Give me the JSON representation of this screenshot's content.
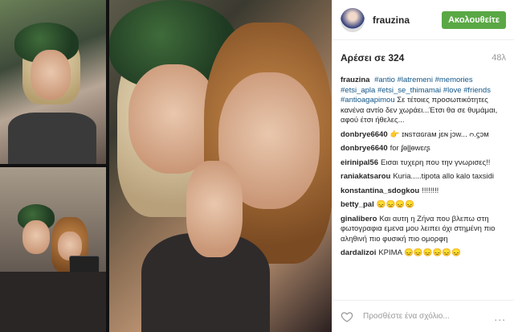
{
  "post": {
    "username": "frauzina",
    "follow_label": "Ακολουθείτε",
    "likes_label": "Αρέσει σε 324",
    "time_ago": "48λ",
    "caption": {
      "user": "frauzina",
      "tags_1": "#antio #latremeni #memories #etsi_apla #etsi_se_thimamai #love #friends #antioagapimou",
      "text": "Σε τέτοιες προσωπικότητες κανένα αντίο δεν χωράει...Έτσι θα σε θυμάμαι, αφού έτσι ήθελες..."
    },
    "comments": [
      {
        "user": "donbrye6640",
        "text": "👉 ɪɴsтαɢraм ȷ̇ɛɴ ȷ̇ɔw... ᴒ.ϛɔм"
      },
      {
        "user": "donbrye6640",
        "text": "for ʄɵɭɭɵwɛɾʂ"
      },
      {
        "user": "eirinipal56",
        "text": "Εισαι τυχερη που την γνωρισες!!"
      },
      {
        "user": "raniakatsarou",
        "text": "Kuria.....tipota allo kalo taxsidi"
      },
      {
        "user": "konstantina_sdogkou",
        "text": "!!!!!!!!"
      },
      {
        "user": "betty_pal",
        "text": "😞😞😞😞"
      },
      {
        "user": "ginalibero",
        "text": "Και αυτη η Ζήνα που βλεπω στη φωτογραφια εμενα μου λειπει όχι στημένη πιο αληθινή πιο φυσική πιο ομορφη"
      },
      {
        "user": "dardalizoi",
        "text": "ΚΡΙΜΑ 😞😞😞😞😞😞"
      }
    ],
    "add_comment_placeholder": "Προσθέστε ένα σχόλιο...",
    "more_label": "...",
    "icons": {
      "like": "heart-icon",
      "more": "more-options-icon"
    }
  }
}
